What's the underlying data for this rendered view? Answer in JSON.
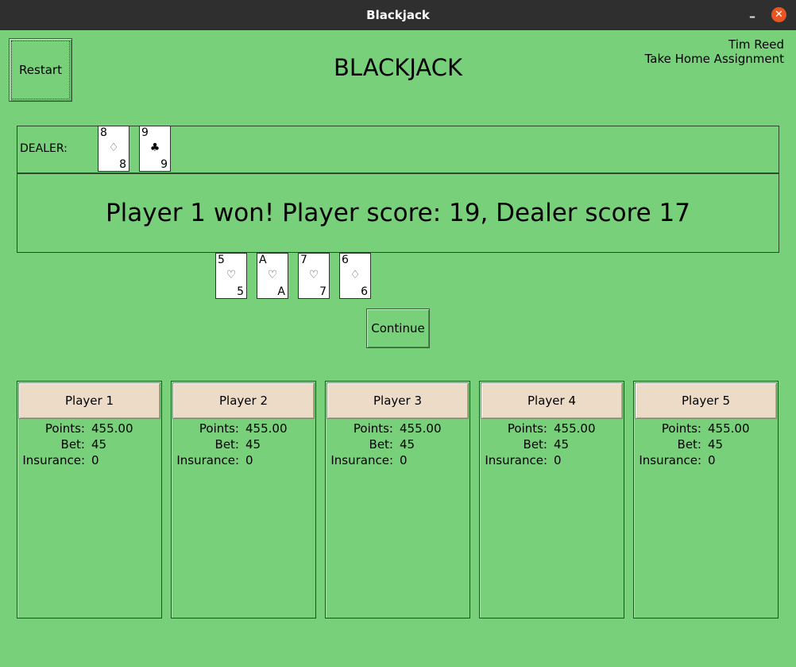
{
  "window": {
    "title": "Blackjack",
    "minimize_symbol": "–",
    "close_symbol": "✕"
  },
  "header": {
    "restart_label": "Restart",
    "title": "BLACKJACK",
    "author_name": "Tim Reed",
    "author_subtitle": "Take Home Assignment"
  },
  "dealer": {
    "label": "DEALER:",
    "cards": [
      {
        "rank": "8",
        "suit": "♢",
        "suit_color": "#444444"
      },
      {
        "rank": "9",
        "suit": "♣",
        "suit_color": "#000000"
      }
    ]
  },
  "message": "Player 1 won! Player score: 19, Dealer score 17",
  "player_hand": {
    "cards": [
      {
        "rank": "5",
        "suit": "♡",
        "suit_color": "#444444"
      },
      {
        "rank": "A",
        "suit": "♡",
        "suit_color": "#444444"
      },
      {
        "rank": "7",
        "suit": "♡",
        "suit_color": "#444444"
      },
      {
        "rank": "6",
        "suit": "♢",
        "suit_color": "#444444"
      }
    ]
  },
  "continue_label": "Continue",
  "stat_labels": {
    "points": "Points:",
    "bet": "Bet:",
    "insurance": "Insurance:"
  },
  "players": [
    {
      "name": "Player 1",
      "points": "455.00",
      "bet": "45",
      "insurance": "0"
    },
    {
      "name": "Player 2",
      "points": "455.00",
      "bet": "45",
      "insurance": "0"
    },
    {
      "name": "Player 3",
      "points": "455.00",
      "bet": "45",
      "insurance": "0"
    },
    {
      "name": "Player 4",
      "points": "455.00",
      "bet": "45",
      "insurance": "0"
    },
    {
      "name": "Player 5",
      "points": "455.00",
      "bet": "45",
      "insurance": "0"
    }
  ],
  "colors": {
    "table_green": "#78d17a",
    "header_tan": "#ecdbc6",
    "titlebar": "#2f2f2f",
    "close_orange": "#e95420"
  }
}
